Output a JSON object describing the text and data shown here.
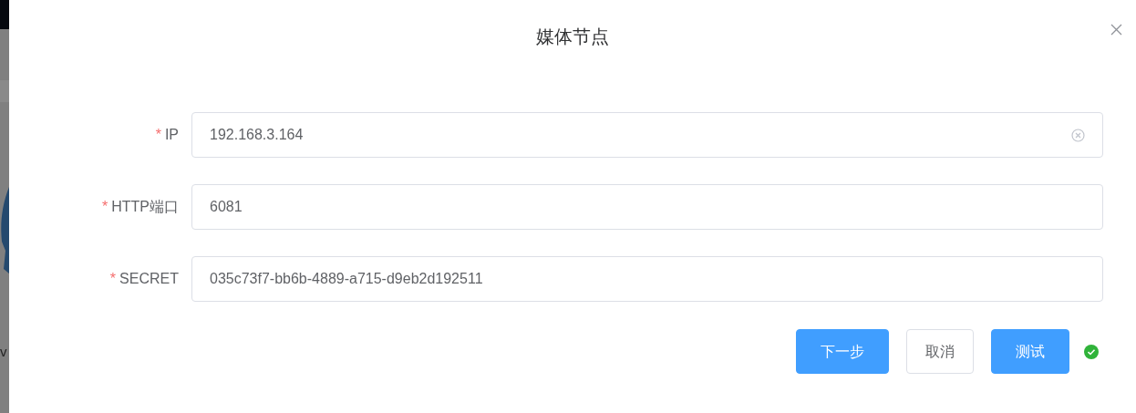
{
  "backdrop": {
    "text": "v"
  },
  "dialog": {
    "title": "媒体节点",
    "fields": [
      {
        "label": "IP",
        "required_mark": "*",
        "value": "192.168.3.164",
        "clearable": true
      },
      {
        "label": "HTTP端口",
        "required_mark": "*",
        "value": "6081",
        "clearable": false
      },
      {
        "label": "SECRET",
        "required_mark": "*",
        "value": "035c73f7-bb6b-4889-a715-d9eb2d192511",
        "clearable": false
      }
    ],
    "buttons": [
      {
        "label": "下一步",
        "kind": "primary"
      },
      {
        "label": "取消",
        "kind": "default"
      },
      {
        "label": "测试",
        "kind": "primary"
      }
    ],
    "test_passed": true
  }
}
